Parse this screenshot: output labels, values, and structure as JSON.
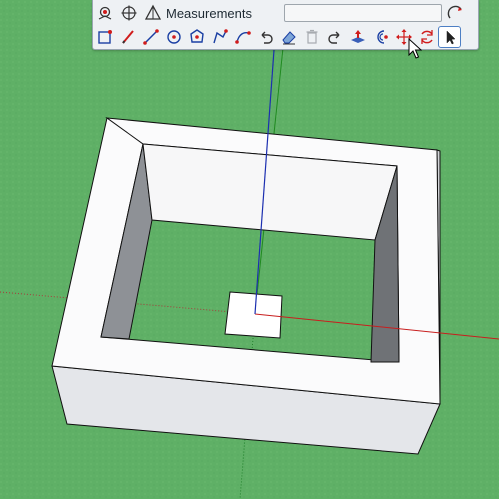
{
  "measurements": {
    "label": "Measurements",
    "value": ""
  },
  "toolbar": {
    "row1_icons": [
      "position-camera-icon",
      "orbit-icon",
      "measurements-triangle-icon"
    ],
    "row2_icons": [
      "select-box-icon",
      "pencil-icon",
      "line-icon",
      "circle-icon",
      "polygon-icon",
      "polyline-icon",
      "arc-icon",
      "undo-icon",
      "eraser-icon",
      "trash-icon",
      "redo-icon",
      "push-pull-icon",
      "offset-icon",
      "move-icon",
      "rotate-icon",
      "select-arrow-icon"
    ],
    "active_tool": "select-arrow-icon"
  },
  "scene": {
    "background": "#5fb066",
    "axis_colors": {
      "red": "#c81e1e",
      "green": "#1f8a1f",
      "blue": "#1c2fb0"
    }
  }
}
